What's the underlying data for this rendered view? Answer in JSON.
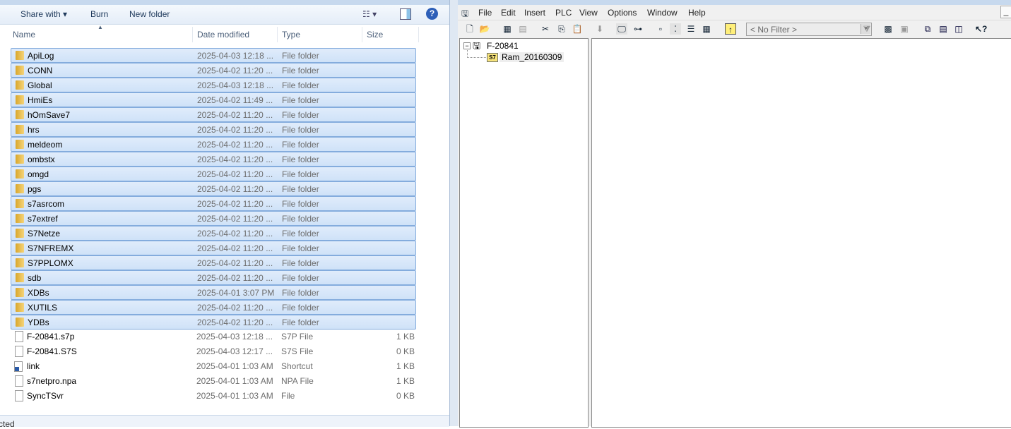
{
  "explorer": {
    "toolbar": {
      "share_with": "Share with ▾",
      "burn": "Burn",
      "new_folder": "New folder"
    },
    "columns": {
      "name": "Name",
      "date": "Date modified",
      "type": "Type",
      "size": "Size"
    },
    "rows": [
      {
        "name": "ApiLog",
        "date": "2025-04-03 12:18 ...",
        "type": "File folder",
        "size": "",
        "kind": "folder"
      },
      {
        "name": "CONN",
        "date": "2025-04-02 11:20 ...",
        "type": "File folder",
        "size": "",
        "kind": "folder"
      },
      {
        "name": "Global",
        "date": "2025-04-03 12:18 ...",
        "type": "File folder",
        "size": "",
        "kind": "folder"
      },
      {
        "name": "HmiEs",
        "date": "2025-04-02 11:49 ...",
        "type": "File folder",
        "size": "",
        "kind": "folder"
      },
      {
        "name": "hOmSave7",
        "date": "2025-04-02 11:20 ...",
        "type": "File folder",
        "size": "",
        "kind": "folder"
      },
      {
        "name": "hrs",
        "date": "2025-04-02 11:20 ...",
        "type": "File folder",
        "size": "",
        "kind": "folder"
      },
      {
        "name": "meldeom",
        "date": "2025-04-02 11:20 ...",
        "type": "File folder",
        "size": "",
        "kind": "folder"
      },
      {
        "name": "ombstx",
        "date": "2025-04-02 11:20 ...",
        "type": "File folder",
        "size": "",
        "kind": "folder"
      },
      {
        "name": "omgd",
        "date": "2025-04-02 11:20 ...",
        "type": "File folder",
        "size": "",
        "kind": "folder"
      },
      {
        "name": "pgs",
        "date": "2025-04-02 11:20 ...",
        "type": "File folder",
        "size": "",
        "kind": "folder"
      },
      {
        "name": "s7asrcom",
        "date": "2025-04-02 11:20 ...",
        "type": "File folder",
        "size": "",
        "kind": "folder"
      },
      {
        "name": "s7extref",
        "date": "2025-04-02 11:20 ...",
        "type": "File folder",
        "size": "",
        "kind": "folder"
      },
      {
        "name": "S7Netze",
        "date": "2025-04-02 11:20 ...",
        "type": "File folder",
        "size": "",
        "kind": "folder"
      },
      {
        "name": "S7NFREMX",
        "date": "2025-04-02 11:20 ...",
        "type": "File folder",
        "size": "",
        "kind": "folder"
      },
      {
        "name": "S7PPLOMX",
        "date": "2025-04-02 11:20 ...",
        "type": "File folder",
        "size": "",
        "kind": "folder"
      },
      {
        "name": "sdb",
        "date": "2025-04-02 11:20 ...",
        "type": "File folder",
        "size": "",
        "kind": "folder"
      },
      {
        "name": "XDBs",
        "date": "2025-04-01 3:07 PM",
        "type": "File folder",
        "size": "",
        "kind": "folder"
      },
      {
        "name": "XUTILS",
        "date": "2025-04-02 11:20 ...",
        "type": "File folder",
        "size": "",
        "kind": "folder"
      },
      {
        "name": "YDBs",
        "date": "2025-04-02 11:20 ...",
        "type": "File folder",
        "size": "",
        "kind": "folder"
      },
      {
        "name": "F-20841.s7p",
        "date": "2025-04-03 12:18 ...",
        "type": "S7P File",
        "size": "1 KB",
        "kind": "file"
      },
      {
        "name": "F-20841.S7S",
        "date": "2025-04-03 12:17 ...",
        "type": "S7S File",
        "size": "0 KB",
        "kind": "file"
      },
      {
        "name": "link",
        "date": "2025-04-01 1:03 AM",
        "type": "Shortcut",
        "size": "1 KB",
        "kind": "shortcut"
      },
      {
        "name": "s7netpro.npa",
        "date": "2025-04-01 1:03 AM",
        "type": "NPA File",
        "size": "1 KB",
        "kind": "file"
      },
      {
        "name": "SyncTSvr",
        "date": "2025-04-01 1:03 AM",
        "type": "File",
        "size": "0 KB",
        "kind": "file"
      }
    ],
    "status": "cted"
  },
  "simatic": {
    "menu": [
      "File",
      "Edit",
      "Insert",
      "PLC",
      "View",
      "Options",
      "Window",
      "Help"
    ],
    "filter": "< No Filter >",
    "tree": {
      "root": "F-20841",
      "child": "Ram_20160309",
      "child_badge": "S7"
    }
  }
}
